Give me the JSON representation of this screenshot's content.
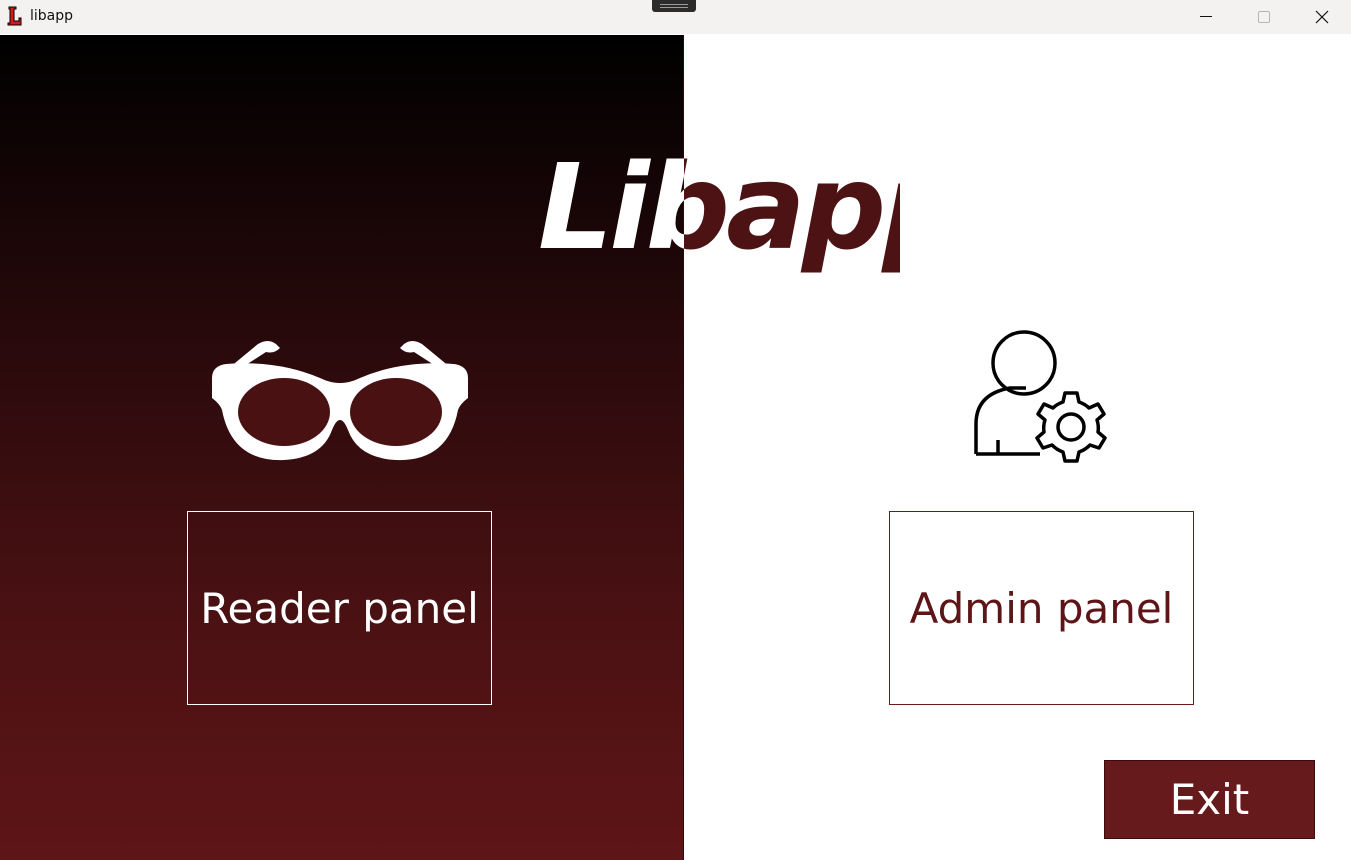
{
  "window": {
    "title": "libapp"
  },
  "logo": {
    "part_left": "Lib",
    "part_right": "app"
  },
  "icons": {
    "app": "app-logo-L-icon",
    "reader": "glasses-icon",
    "admin": "user-gear-icon",
    "minimize": "minimize-icon",
    "maximize": "maximize-icon",
    "close": "close-icon"
  },
  "buttons": {
    "reader": "Reader panel",
    "admin": "Admin panel",
    "exit": "Exit"
  },
  "colors": {
    "brand": "#5e1517",
    "exit_bg": "#661a1b",
    "left_gradient_top": "#000000",
    "left_gradient_bottom": "#5e1517"
  }
}
